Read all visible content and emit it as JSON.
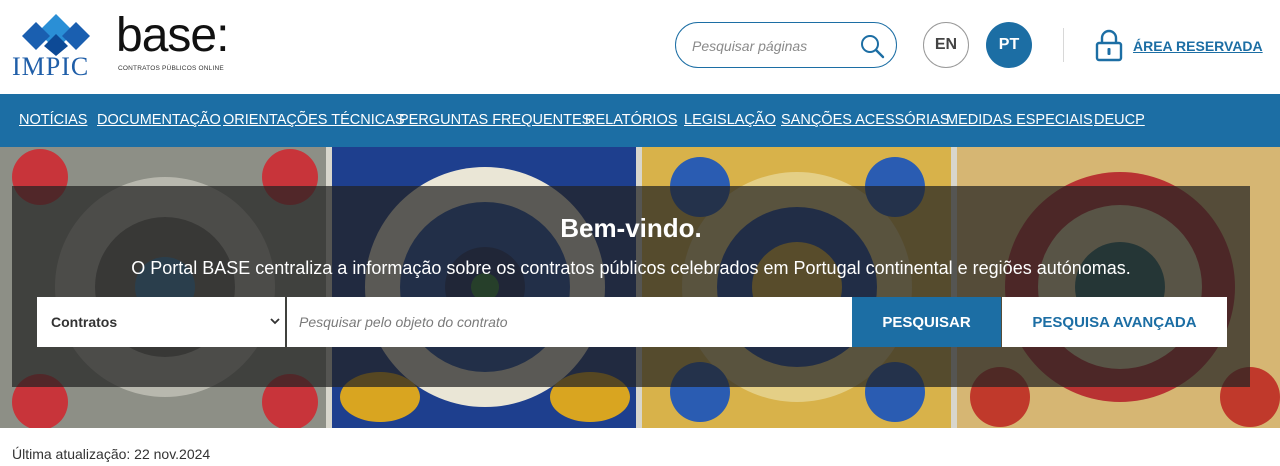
{
  "header": {
    "impic_logo_text": "IMPIC",
    "base_logo_text": "base:",
    "base_logo_tagline": "CONTRATOS PÚBLICOS ONLINE",
    "search_placeholder": "Pesquisar páginas",
    "lang_en": "EN",
    "lang_pt": "PT",
    "reserved_area_label": "ÁREA RESERVADA"
  },
  "nav": {
    "items": [
      {
        "label": "NOTÍCIAS"
      },
      {
        "label": "DOCUMENTAÇÃO"
      },
      {
        "label": "ORIENTAÇÕES TÉCNICAS"
      },
      {
        "label": "PERGUNTAS FREQUENTES"
      },
      {
        "label": "RELATÓRIOS"
      },
      {
        "label": "LEGISLAÇÃO"
      },
      {
        "label": "SANÇÕES ACESSÓRIAS"
      },
      {
        "label": "MEDIDAS ESPECIAIS"
      },
      {
        "label": "DEUCP"
      }
    ]
  },
  "hero": {
    "title": "Bem-vindo.",
    "subtitle": "O Portal BASE centraliza a informação sobre os contratos públicos celebrados em Portugal continental e regiões autónomas.",
    "type_select_value": "Contratos",
    "contract_search_placeholder": "Pesquisar pelo objeto do contrato",
    "search_button": "PESQUISAR",
    "advanced_search_button": "PESQUISA AVANÇADA"
  },
  "footer": {
    "last_update": "Última atualização: 22 nov.2024"
  },
  "colors": {
    "brand_blue": "#1c6ea4",
    "logo_blue": "#1f5ea8",
    "overlay": "rgba(35,35,35,0.72)"
  },
  "icons": {
    "search": "search-icon",
    "lock": "lock-icon",
    "chevron": "chevron-down-icon"
  }
}
